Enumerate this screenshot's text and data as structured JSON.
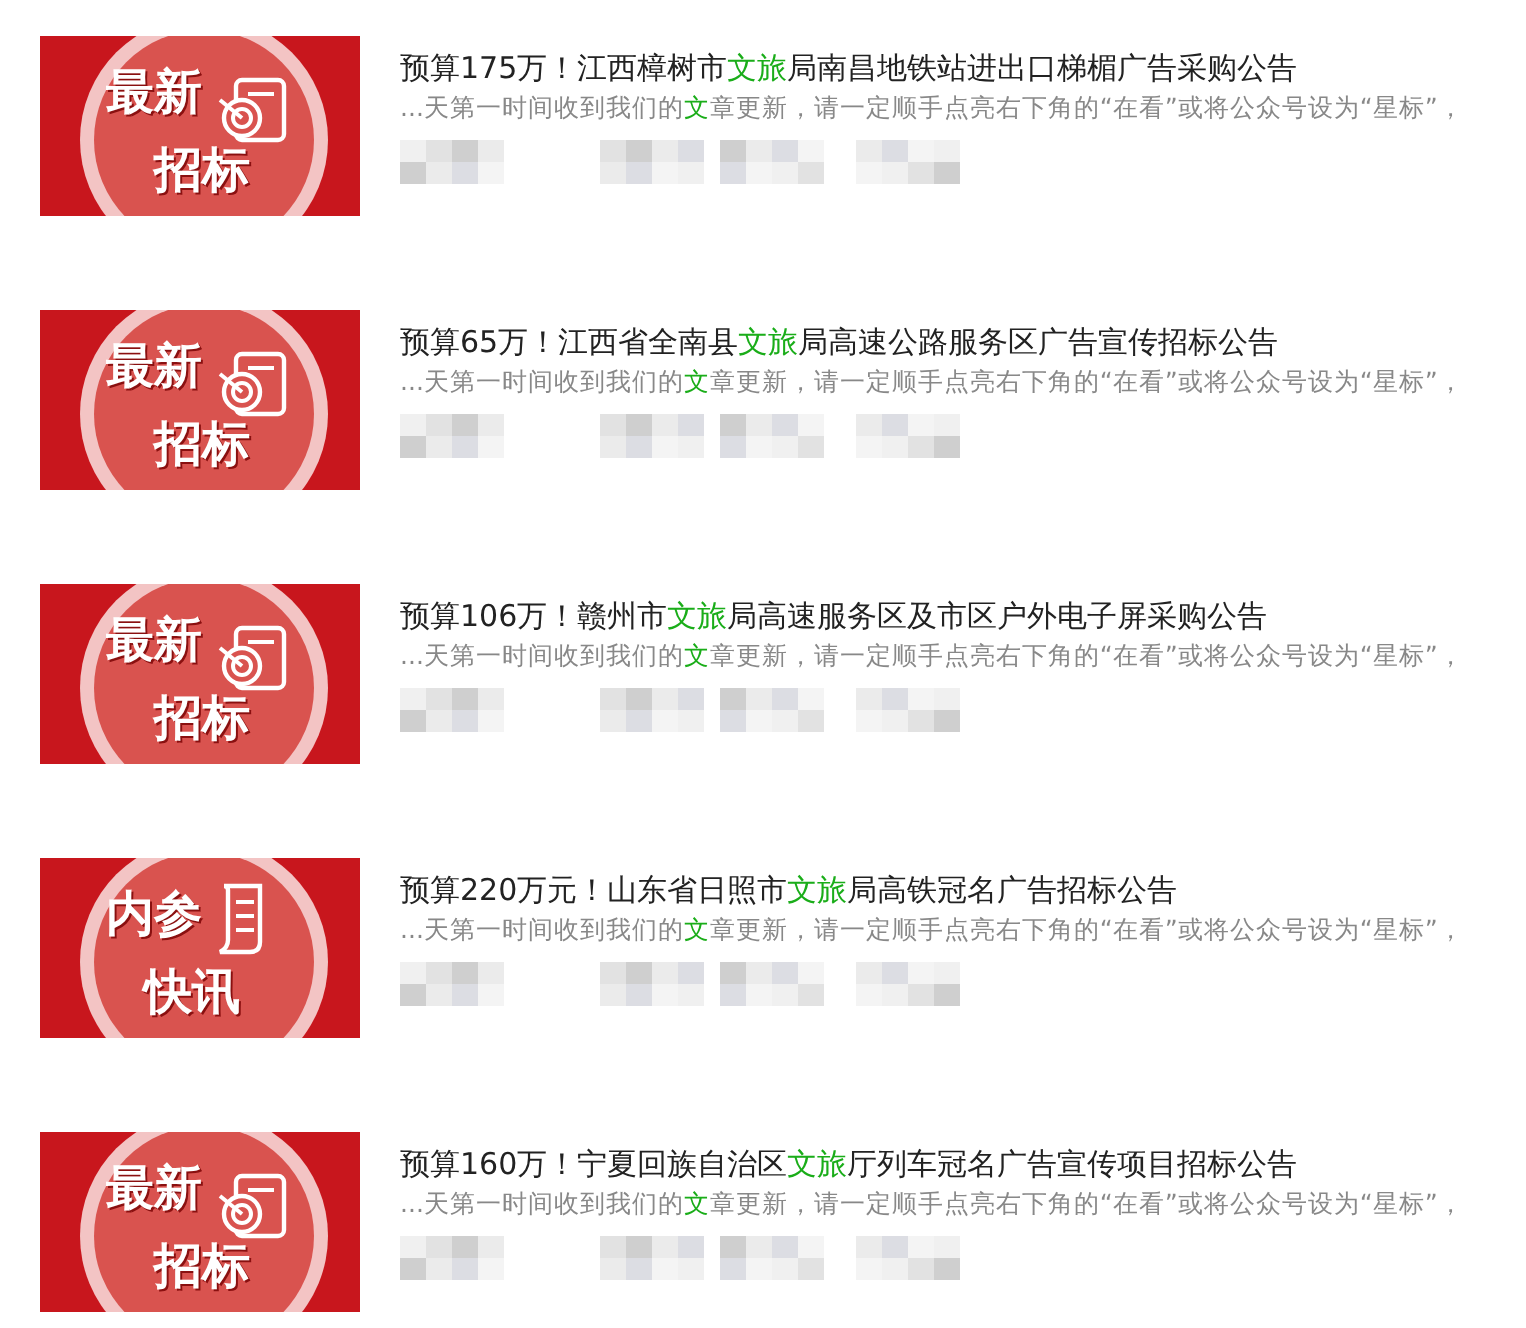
{
  "articles": [
    {
      "badge": {
        "kind": "target",
        "line1": "最新",
        "line2": "招标"
      },
      "title": [
        {
          "text": "预算175万！江西樟树市",
          "highlight": false
        },
        {
          "text": "文旅",
          "highlight": true
        },
        {
          "text": "局南昌地铁站进出口梯楣广告采购公告",
          "highlight": false
        }
      ],
      "snippet": [
        {
          "text": "...天第一时间收到我们的",
          "highlight": false
        },
        {
          "text": "文",
          "highlight": true
        },
        {
          "text": "章更新，请一定顺手点亮右下角的“在看”或将公众号设为“星标”，",
          "highlight": false
        }
      ]
    },
    {
      "badge": {
        "kind": "target",
        "line1": "最新",
        "line2": "招标"
      },
      "title": [
        {
          "text": "预算65万！江西省全南县",
          "highlight": false
        },
        {
          "text": "文旅",
          "highlight": true
        },
        {
          "text": "局高速公路服务区广告宣传招标公告",
          "highlight": false
        }
      ],
      "snippet": [
        {
          "text": "...天第一时间收到我们的",
          "highlight": false
        },
        {
          "text": "文",
          "highlight": true
        },
        {
          "text": "章更新，请一定顺手点亮右下角的“在看”或将公众号设为“星标”，",
          "highlight": false
        }
      ]
    },
    {
      "badge": {
        "kind": "target",
        "line1": "最新",
        "line2": "招标"
      },
      "title": [
        {
          "text": "预算106万！赣州市",
          "highlight": false
        },
        {
          "text": "文旅",
          "highlight": true
        },
        {
          "text": "局高速服务区及市区户外电子屏采购公告",
          "highlight": false
        }
      ],
      "snippet": [
        {
          "text": "...天第一时间收到我们的",
          "highlight": false
        },
        {
          "text": "文",
          "highlight": true
        },
        {
          "text": "章更新，请一定顺手点亮右下角的“在看”或将公众号设为“星标”，",
          "highlight": false
        }
      ]
    },
    {
      "badge": {
        "kind": "scroll",
        "line1": "内参",
        "line2": "快讯"
      },
      "title": [
        {
          "text": "预算220万元！山东省日照市",
          "highlight": false
        },
        {
          "text": "文旅",
          "highlight": true
        },
        {
          "text": "局高铁冠名广告招标公告",
          "highlight": false
        }
      ],
      "snippet": [
        {
          "text": "...天第一时间收到我们的",
          "highlight": false
        },
        {
          "text": "文",
          "highlight": true
        },
        {
          "text": "章更新，请一定顺手点亮右下角的“在看”或将公众号设为“星标”，",
          "highlight": false
        }
      ]
    },
    {
      "badge": {
        "kind": "target",
        "line1": "最新",
        "line2": "招标"
      },
      "title": [
        {
          "text": "预算160万！宁夏回族自治区",
          "highlight": false
        },
        {
          "text": "文旅",
          "highlight": true
        },
        {
          "text": "厅列车冠名广告宣传项目招标公告",
          "highlight": false
        }
      ],
      "snippet": [
        {
          "text": "...天第一时间收到我们的",
          "highlight": false
        },
        {
          "text": "文",
          "highlight": true
        },
        {
          "text": "章更新，请一定顺手点亮右下角的“在看”或将公众号设为“星标”，",
          "highlight": false
        }
      ]
    }
  ]
}
